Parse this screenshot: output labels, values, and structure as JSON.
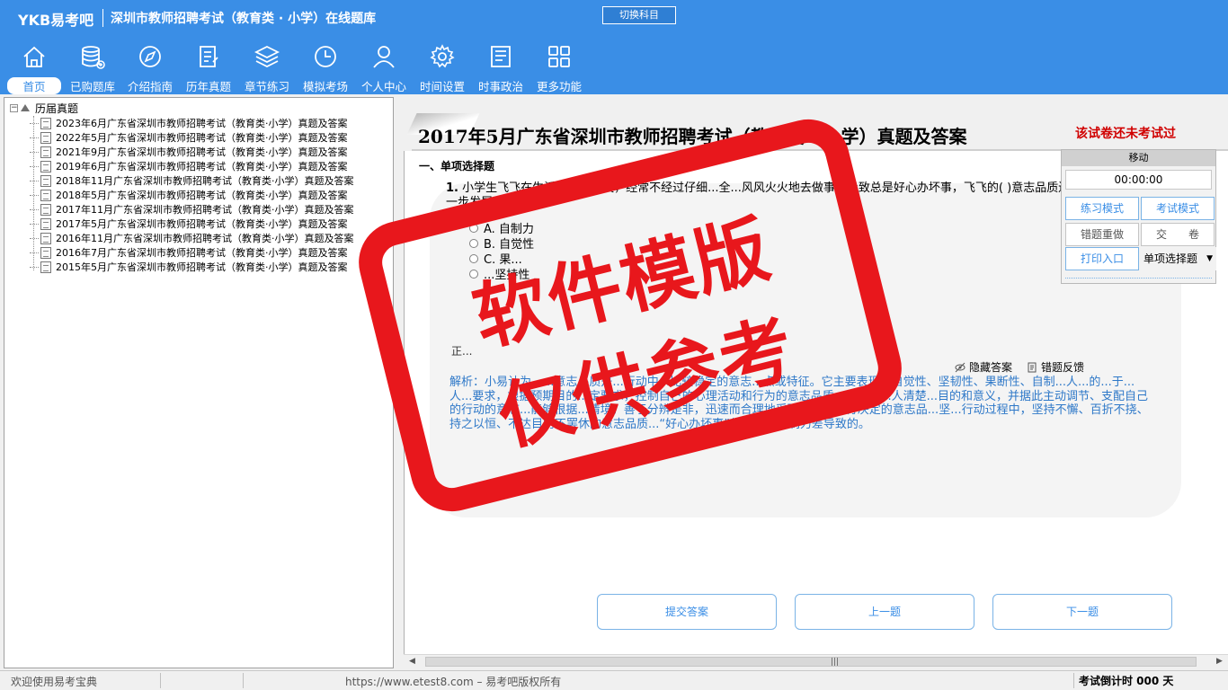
{
  "header": {
    "logo": "YKB易考吧",
    "title": "深圳市教师招聘考试（教育类 · 小学）在线题库",
    "switch_label": "切换科目"
  },
  "nav": [
    {
      "label": "首页",
      "icon": "home-icon"
    },
    {
      "label": "已购题库",
      "icon": "database-icon"
    },
    {
      "label": "介绍指南",
      "icon": "compass-icon"
    },
    {
      "label": "历年真题",
      "icon": "document-list-icon"
    },
    {
      "label": "章节练习",
      "icon": "layers-icon"
    },
    {
      "label": "模拟考场",
      "icon": "clock-icon"
    },
    {
      "label": "个人中心",
      "icon": "user-icon"
    },
    {
      "label": "时间设置",
      "icon": "gear-icon"
    },
    {
      "label": "时事政治",
      "icon": "news-icon"
    },
    {
      "label": "更多功能",
      "icon": "grid-icon"
    }
  ],
  "tree": {
    "root": "历届真题",
    "items": [
      "2023年6月广东省深圳市教师招聘考试（教育类·小学）真题及答案",
      "2022年5月广东省深圳市教师招聘考试（教育类·小学）真题及答案",
      "2021年9月广东省深圳市教师招聘考试（教育类·小学）真题及答案",
      "2019年6月广东省深圳市教师招聘考试（教育类·小学）真题及答案",
      "2018年11月广东省深圳市教师招聘考试（教育类·小学）真题及答案",
      "2018年5月广东省深圳市教师招聘考试（教育类·小学）真题及答案",
      "2017年11月广东省深圳市教师招聘考试（教育类·小学）真题及答案",
      "2017年5月广东省深圳市教师招聘考试（教育类·小学）真题及答案",
      "2016年11月广东省深圳市教师招聘考试（教育类·小学）真题及答案",
      "2016年7月广东省深圳市教师招聘考试（教育类·小学）真题及答案",
      "2015年5月广东省深圳市教师招聘考试（教育类·小学）真题及答案"
    ]
  },
  "exam": {
    "title": "2017年5月广东省深圳市教师招聘考试（教育类 · 小学）真题及答案",
    "status": "该试卷还未考试过",
    "section": "一、单项选择题",
    "question_num": "1.",
    "question_text": "小学生飞飞在生活中比较冒失，经常不经过仔细...全...风风火火地去做事，导致总是好心办坏事，飞飞的( )意志品质还需要进一步发展。",
    "options": [
      "A. 自制力",
      "B. 自觉性",
      "C. 果...",
      "...坚持性"
    ],
    "hide_answer": "隐藏答案",
    "feedback": "错题反馈",
    "analysis_head": "正...",
    "analysis": "解析：小易认为，...意志品质是...行动中...比较稳定的意志...点或特征。它主要表现在自觉性、坚韧性、果断性、自制...人...的...于...人...要求，根据预期目的...定要求，控制自己的心理活动和行为的意志品质。意...自...人清楚...目的和意义，并据此主动调节、支配自己的行动的意志...能够根据...情境，善于分辨是非，迅速而合理地采取决定和执行决定的意志品...坚...行动过程中，坚持不懈、百折不挠、持之以恒、不达目的不罢休的意志品质...“好心办坏事”都是意志自制力差导致的。"
  },
  "buttons": {
    "submit": "提交答案",
    "prev": "上一题",
    "next": "下一题"
  },
  "tool_panel": {
    "move": "移动",
    "timer": "00:00:00",
    "practice_mode": "练习模式",
    "exam_mode": "考试模式",
    "redo_wrong": "错题重做",
    "submit_paper": "交　　卷",
    "print": "打印入口",
    "question_type": "单项选择题"
  },
  "watermark": {
    "line1": "软件模版",
    "line2": "仅供参考"
  },
  "statusbar": {
    "welcome": "欢迎使用易考宝典",
    "url": "https://www.etest8.com – 易考吧版权所有",
    "countdown": "考试倒计时 000 天"
  },
  "colors": {
    "brand_blue": "#3a8ee6",
    "warning_red": "#d00000",
    "watermark_red": "#e8171c",
    "analysis_blue": "#2e78c8"
  }
}
